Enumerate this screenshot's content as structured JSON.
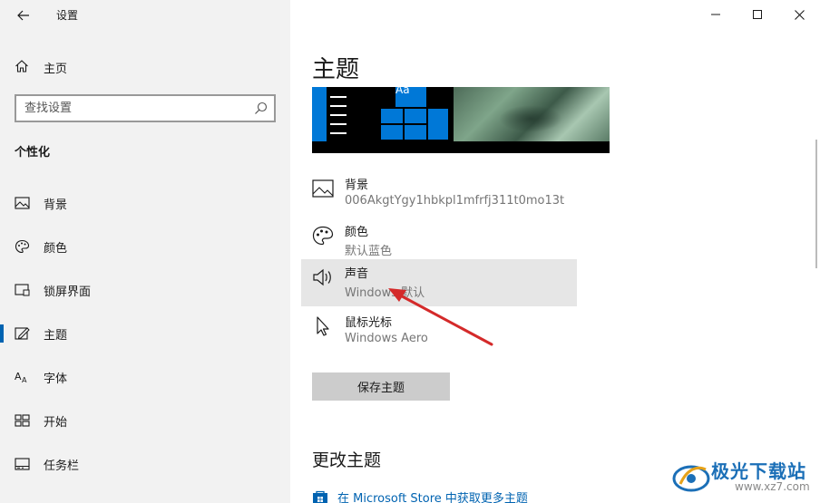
{
  "window": {
    "title": "设置"
  },
  "sidebar": {
    "home_label": "主页",
    "search_placeholder": "查找设置",
    "section_label": "个性化",
    "items": [
      {
        "label": "背景",
        "icon": "image-icon"
      },
      {
        "label": "颜色",
        "icon": "palette-icon"
      },
      {
        "label": "锁屏界面",
        "icon": "lock-screen-icon"
      },
      {
        "label": "主题",
        "icon": "theme-icon",
        "active": true
      },
      {
        "label": "字体",
        "icon": "font-icon"
      },
      {
        "label": "开始",
        "icon": "start-icon"
      },
      {
        "label": "任务栏",
        "icon": "taskbar-icon"
      }
    ]
  },
  "main": {
    "title": "主题",
    "preview_tile_text": "Aa",
    "options": [
      {
        "title": "背景",
        "subtitle": "006AkgtYgy1hbkpl1mfrfj311t0mo13t",
        "icon": "image-icon"
      },
      {
        "title": "颜色",
        "subtitle": "默认蓝色",
        "icon": "palette-icon"
      },
      {
        "title": "声音",
        "subtitle": "Windows 默认",
        "icon": "speaker-icon",
        "highlighted": true
      },
      {
        "title": "鼠标光标",
        "subtitle": "Windows Aero",
        "icon": "cursor-icon"
      }
    ],
    "save_button": "保存主题",
    "change_title": "更改主题",
    "store_link": "在 Microsoft Store 中获取更多主题"
  },
  "watermark": {
    "name": "极光下载站",
    "url": "www.xz7.com"
  },
  "colors": {
    "accent": "#0078d7",
    "link": "#0063b1",
    "sidebar_bg": "#f2f2f2",
    "arrow": "#d42a2a"
  }
}
